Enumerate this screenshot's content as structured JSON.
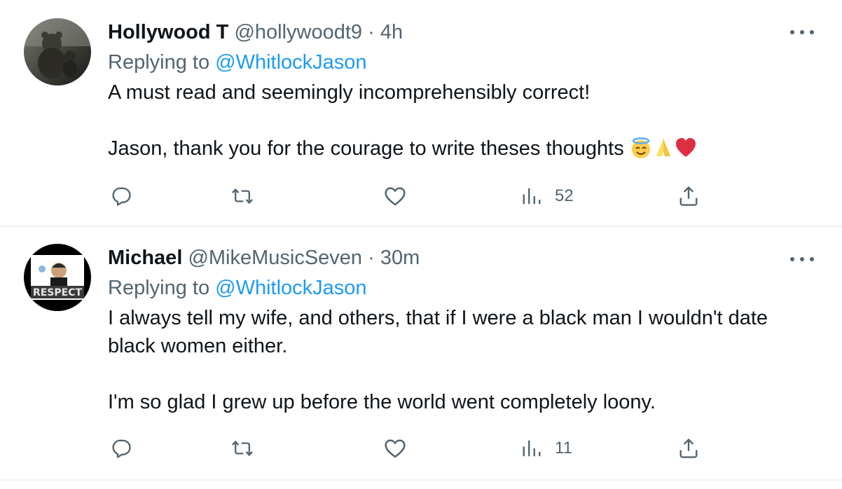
{
  "replies": [
    {
      "display_name": "Hollywood T",
      "handle": "@hollywoodt9",
      "separator": "·",
      "timestamp": "4h",
      "replying_prefix": "Replying to",
      "replying_to": "@WhitlockJason",
      "text_line_1": "A must read and seemingly incomprehensibly correct!",
      "text_line_2": "Jason, thank you for the courage to write theses thoughts",
      "emojis": [
        "smiling-face-with-halo",
        "folded-hands",
        "red-heart"
      ],
      "views_count": "52",
      "avatar": "teddy-bear-photo"
    },
    {
      "display_name": "Michael",
      "handle": "@MikeMusicSeven",
      "separator": "·",
      "timestamp": "30m",
      "replying_prefix": "Replying to",
      "replying_to": "@WhitlockJason",
      "text_line_1": "I always tell my wife, and others, that if I were a  black man I wouldn't date",
      "text_line_2": "black women either.",
      "text_line_3": "I'm so glad I grew up before the world went completely loony.",
      "views_count": "11",
      "avatar": "respect-badge",
      "avatar_text": "RESPECT"
    }
  ],
  "colors": {
    "text_primary": "#0f1419",
    "text_secondary": "#536471",
    "link": "#1d9bf0",
    "divider": "#eff3f4"
  },
  "icons": [
    "reply-icon",
    "retweet-icon",
    "like-icon",
    "views-icon",
    "share-icon",
    "more-icon"
  ]
}
